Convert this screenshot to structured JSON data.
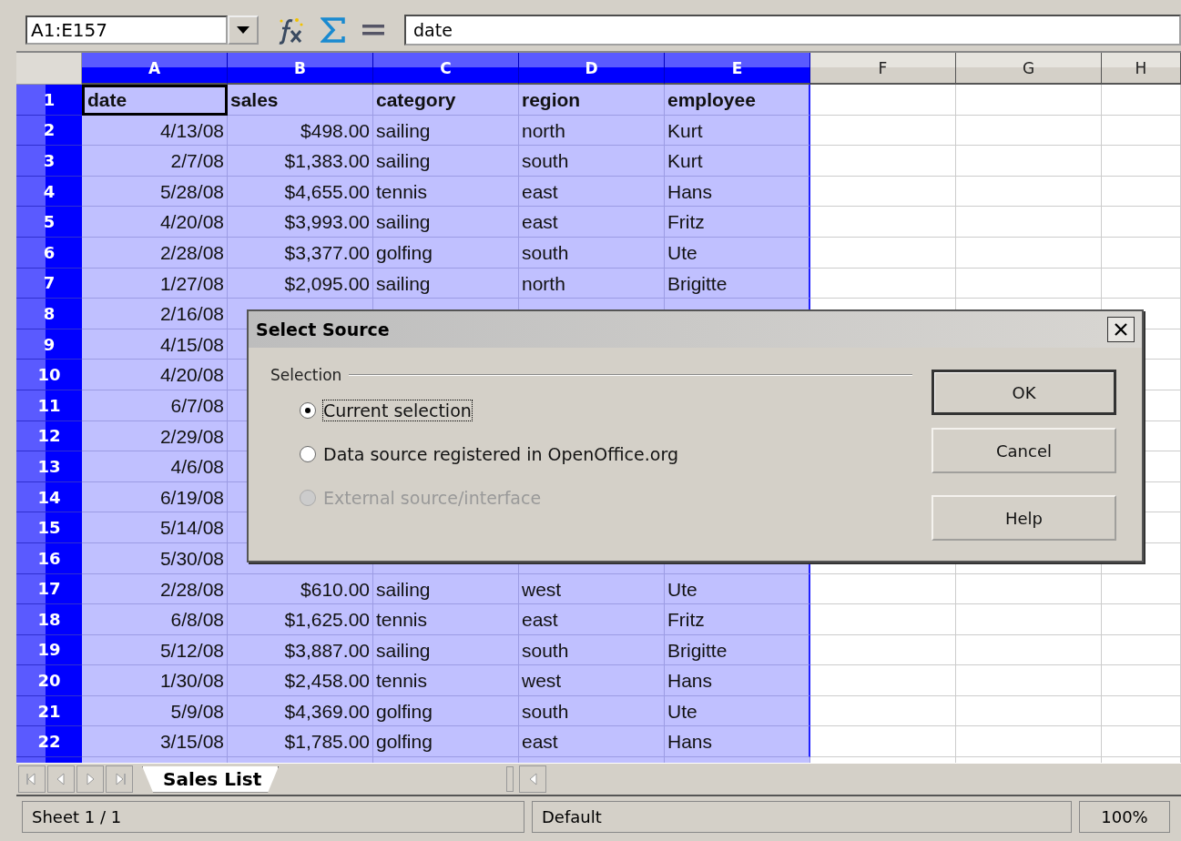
{
  "name_box": {
    "value": "A1:E157"
  },
  "formula": {
    "value": "date"
  },
  "columns": [
    {
      "label": "A",
      "selected": true
    },
    {
      "label": "B",
      "selected": true
    },
    {
      "label": "C",
      "selected": true
    },
    {
      "label": "D",
      "selected": true
    },
    {
      "label": "E",
      "selected": true
    },
    {
      "label": "F",
      "selected": false
    },
    {
      "label": "G",
      "selected": false
    },
    {
      "label": "H",
      "selected": false
    }
  ],
  "rows": [
    {
      "label": "1",
      "selected": true,
      "kind": "header",
      "active": true,
      "cells": [
        "date",
        "sales",
        "category",
        "region",
        "employee"
      ]
    },
    {
      "label": "2",
      "selected": true,
      "kind": "data",
      "active": false,
      "cells": [
        "4/13/08",
        "$498.00",
        "sailing",
        "north",
        "Kurt"
      ]
    },
    {
      "label": "3",
      "selected": true,
      "kind": "data",
      "active": false,
      "cells": [
        "2/7/08",
        "$1,383.00",
        "sailing",
        "south",
        "Kurt"
      ]
    },
    {
      "label": "4",
      "selected": true,
      "kind": "data",
      "active": false,
      "cells": [
        "5/28/08",
        "$4,655.00",
        "tennis",
        "east",
        "Hans"
      ]
    },
    {
      "label": "5",
      "selected": true,
      "kind": "data",
      "active": false,
      "cells": [
        "4/20/08",
        "$3,993.00",
        "sailing",
        "east",
        "Fritz"
      ]
    },
    {
      "label": "6",
      "selected": true,
      "kind": "data",
      "active": false,
      "cells": [
        "2/28/08",
        "$3,377.00",
        "golfing",
        "south",
        "Ute"
      ]
    },
    {
      "label": "7",
      "selected": true,
      "kind": "data",
      "active": false,
      "cells": [
        "1/27/08",
        "$2,095.00",
        "sailing",
        "north",
        "Brigitte"
      ]
    },
    {
      "label": "8",
      "selected": true,
      "kind": "data",
      "active": false,
      "cells": [
        "2/16/08"
      ]
    },
    {
      "label": "9",
      "selected": true,
      "kind": "data",
      "active": false,
      "cells": [
        "4/15/08"
      ]
    },
    {
      "label": "10",
      "selected": true,
      "kind": "data",
      "active": false,
      "cells": [
        "4/20/08"
      ]
    },
    {
      "label": "11",
      "selected": true,
      "kind": "data",
      "active": false,
      "cells": [
        "6/7/08"
      ]
    },
    {
      "label": "12",
      "selected": true,
      "kind": "data",
      "active": false,
      "cells": [
        "2/29/08"
      ]
    },
    {
      "label": "13",
      "selected": true,
      "kind": "data",
      "active": false,
      "cells": [
        "4/6/08"
      ]
    },
    {
      "label": "14",
      "selected": true,
      "kind": "data",
      "active": false,
      "cells": [
        "6/19/08"
      ]
    },
    {
      "label": "15",
      "selected": true,
      "kind": "data",
      "active": false,
      "cells": [
        "5/14/08"
      ]
    },
    {
      "label": "16",
      "selected": true,
      "kind": "data",
      "active": false,
      "cells": [
        "5/30/08"
      ]
    },
    {
      "label": "17",
      "selected": true,
      "kind": "data",
      "active": false,
      "cells": [
        "2/28/08",
        "$610.00",
        "sailing",
        "west",
        "Ute"
      ]
    },
    {
      "label": "18",
      "selected": true,
      "kind": "data",
      "active": false,
      "cells": [
        "6/8/08",
        "$1,625.00",
        "tennis",
        "east",
        "Fritz"
      ]
    },
    {
      "label": "19",
      "selected": true,
      "kind": "data",
      "active": false,
      "cells": [
        "5/12/08",
        "$3,887.00",
        "sailing",
        "south",
        "Brigitte"
      ]
    },
    {
      "label": "20",
      "selected": true,
      "kind": "data",
      "active": false,
      "cells": [
        "1/30/08",
        "$2,458.00",
        "tennis",
        "west",
        "Hans"
      ]
    },
    {
      "label": "21",
      "selected": true,
      "kind": "data",
      "active": false,
      "cells": [
        "5/9/08",
        "$4,369.00",
        "golfing",
        "south",
        "Ute"
      ]
    },
    {
      "label": "22",
      "selected": true,
      "kind": "data",
      "active": false,
      "cells": [
        "3/15/08",
        "$1,785.00",
        "golfing",
        "east",
        "Hans"
      ]
    }
  ],
  "sheet_tabs": [
    {
      "label": "Sales List",
      "selected": true
    }
  ],
  "status_bar": {
    "sheet": "Sheet 1 / 1",
    "page_style": "Default",
    "zoom": "100%"
  },
  "dialog": {
    "title": "Select Source",
    "group": "Selection",
    "options": [
      {
        "label": "Current selection",
        "selected": true,
        "disabled": false
      },
      {
        "label": "Data source registered in OpenOffice.org",
        "selected": false,
        "disabled": false
      },
      {
        "label": "External source/interface",
        "selected": false,
        "disabled": true
      }
    ],
    "buttons": [
      {
        "label": "OK",
        "default": true
      },
      {
        "label": "Cancel",
        "default": false
      },
      {
        "label": "Help",
        "default": false
      }
    ]
  }
}
